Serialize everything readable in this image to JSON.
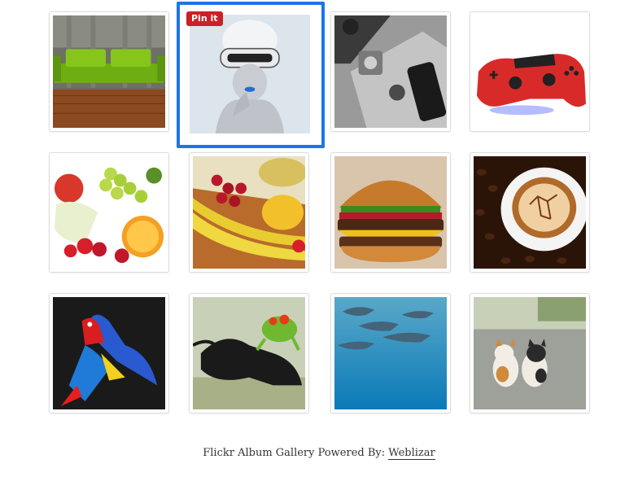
{
  "gallery": {
    "pin_label": "Pin it",
    "selected_index": 1,
    "items": [
      {
        "icon": "sofa-image"
      },
      {
        "icon": "vr-headset-woman-image"
      },
      {
        "icon": "ipad-iphone-image"
      },
      {
        "icon": "game-controller-image"
      },
      {
        "icon": "fruit-image"
      },
      {
        "icon": "banana-fruit-image"
      },
      {
        "icon": "burger-image"
      },
      {
        "icon": "coffee-image"
      },
      {
        "icon": "parrot-image"
      },
      {
        "icon": "frog-beetle-image"
      },
      {
        "icon": "dolphins-image"
      },
      {
        "icon": "kittens-image"
      }
    ]
  },
  "footer": {
    "text": "Flickr Album Gallery Powered By:",
    "link_label": "Weblizar"
  },
  "colors": {
    "selection_border": "#1e74e8",
    "pin_button": "#cb2027"
  }
}
